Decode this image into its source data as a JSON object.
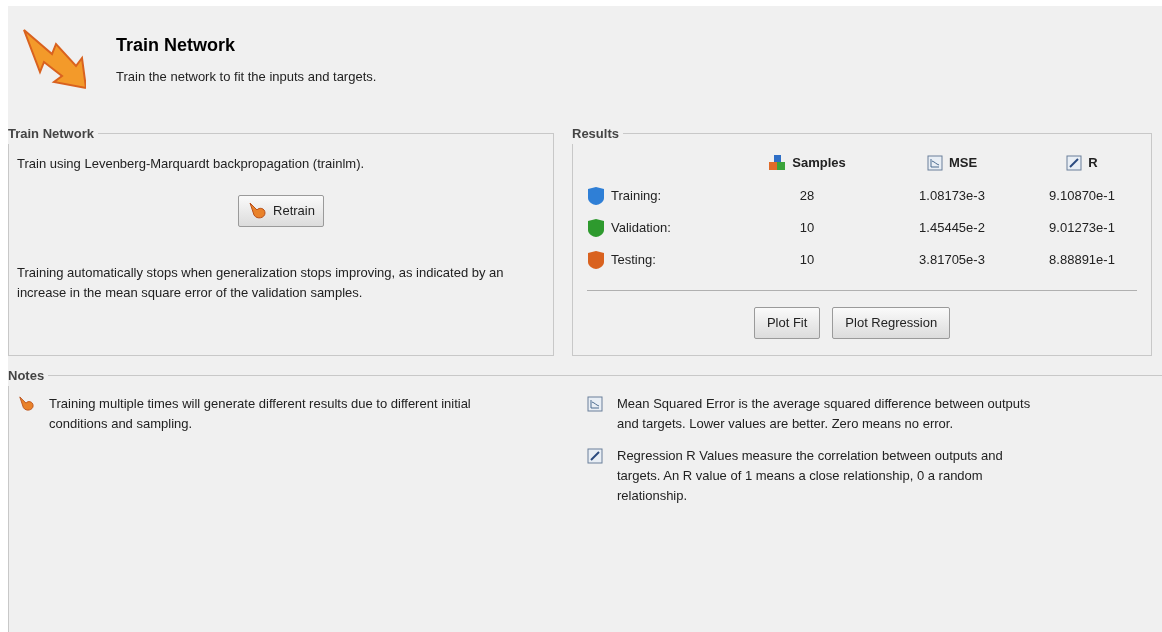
{
  "header": {
    "title": "Train Network",
    "subtitle": "Train the network to fit the inputs and targets."
  },
  "train_panel": {
    "title": "Train Network",
    "description": "Train using Levenberg-Marquardt backpropagation (trainlm).",
    "button": "Retrain",
    "note": "Training automatically stops when generalization stops improving, as indicated by an increase in the mean square error of the validation samples."
  },
  "results": {
    "title": "Results",
    "columns": [
      {
        "kind": "samples",
        "label": "Samples"
      },
      {
        "kind": "mse",
        "label": "MSE"
      },
      {
        "kind": "r",
        "label": "R"
      }
    ],
    "rows": [
      {
        "label": "Training:",
        "color": "#2f7fd6",
        "samples": "28",
        "mse": "1.08173e-3",
        "r": "9.10870e-1"
      },
      {
        "label": "Validation:",
        "color": "#2e9a2e",
        "samples": "10",
        "mse": "1.45445e-2",
        "r": "9.01273e-1"
      },
      {
        "label": "Testing:",
        "color": "#d9621f",
        "samples": "10",
        "mse": "3.81705e-3",
        "r": "8.88891e-1"
      }
    ],
    "buttons": [
      "Plot Fit",
      "Plot Regression"
    ]
  },
  "notes": {
    "title": "Notes",
    "left": [
      {
        "kind": "retrain",
        "text": "Training multiple times will generate different results due to different initial conditions and sampling."
      }
    ],
    "right": [
      {
        "kind": "mse",
        "text": "Mean Squared Error is the average squared difference between outputs and targets. Lower values are better. Zero means no error."
      },
      {
        "kind": "r",
        "text": "Regression R Values measure the correlation between outputs and targets. An R value of 1 means a close relationship, 0 a random relationship."
      }
    ]
  }
}
